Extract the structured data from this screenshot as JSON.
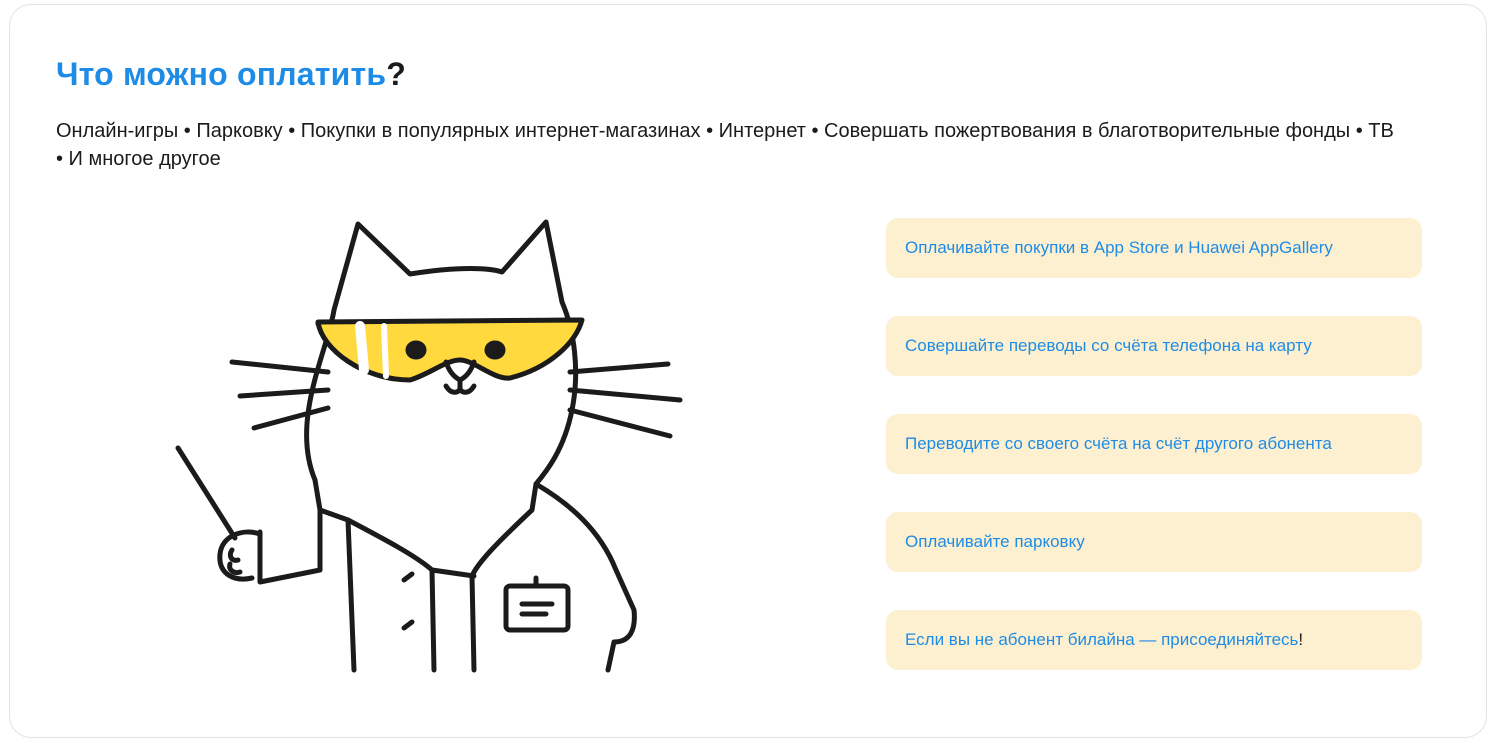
{
  "header": {
    "title_link": "Что можно оплатить",
    "title_tail": "?"
  },
  "intro": {
    "text": "Онлайн-игры • Парковку • Покупки в популярных интернет-магазинах • Интернет • Совершать пожертвования в благотворительные фонды • ТВ • И многое другое"
  },
  "illustration": {
    "icon": "cat-in-safety-goggles-illustration"
  },
  "links": [
    {
      "label": "Оплачивайте покупки в App Store и Huawei AppGallery",
      "tail": ""
    },
    {
      "label": "Совершайте переводы со счёта телефона на карту",
      "tail": ""
    },
    {
      "label": "Переводите со своего счёта на счёт другого абонента",
      "tail": ""
    },
    {
      "label": "Оплачивайте парковку",
      "tail": ""
    },
    {
      "label": "Если вы не абонент билайна — присоединяйтесь",
      "tail": "!"
    }
  ],
  "colors": {
    "accent": "#1e8ce6",
    "pill_bg": "#fdf0d0",
    "goggles": "#ffd93d",
    "text": "#1b1b1b"
  }
}
